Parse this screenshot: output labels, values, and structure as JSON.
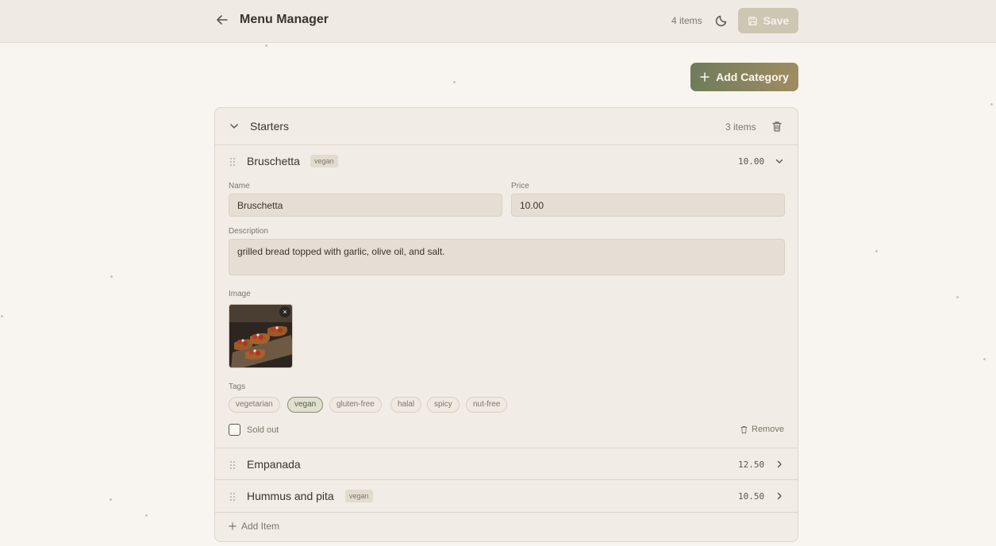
{
  "header": {
    "title": "Menu Manager",
    "item_count": "4 items",
    "save_label": "Save",
    "icons": {
      "back": "arrow-left-icon",
      "theme": "moon-icon",
      "save": "floppy-disk-icon"
    }
  },
  "toolbar": {
    "add_category_label": "Add Category"
  },
  "category": {
    "name": "Starters",
    "item_count": "3 items",
    "items": [
      {
        "name": "Bruschetta",
        "badge": "vegan",
        "price": "10.00",
        "expanded": true
      },
      {
        "name": "Empanada",
        "badge": "",
        "price": "12.50",
        "expanded": false
      },
      {
        "name": "Hummus and pita",
        "badge": "vegan",
        "price": "10.50",
        "expanded": false
      }
    ],
    "add_item_label": "Add Item"
  },
  "editor": {
    "name_label": "Name",
    "name_value": "Bruschetta",
    "price_label": "Price",
    "price_value": "10.00",
    "description_label": "Description",
    "description_value": "grilled bread topped with garlic, olive oil, and salt.",
    "image_label": "Image",
    "image_remove_glyph": "×",
    "tags_label": "Tags",
    "tags": [
      {
        "label": "vegetarian",
        "active": false
      },
      {
        "label": "vegan",
        "active": true
      },
      {
        "label": "gluten-free",
        "active": false
      },
      {
        "label": "halal",
        "active": false
      },
      {
        "label": "spicy",
        "active": false
      },
      {
        "label": "nut-free",
        "active": false
      }
    ],
    "sold_out_label": "Sold out",
    "remove_label": "Remove"
  },
  "colors": {
    "background": "#f8f5f0",
    "accent_start": "#6f7c5a",
    "accent_end": "#a08c62",
    "save_disabled": "#cdc6b3"
  }
}
